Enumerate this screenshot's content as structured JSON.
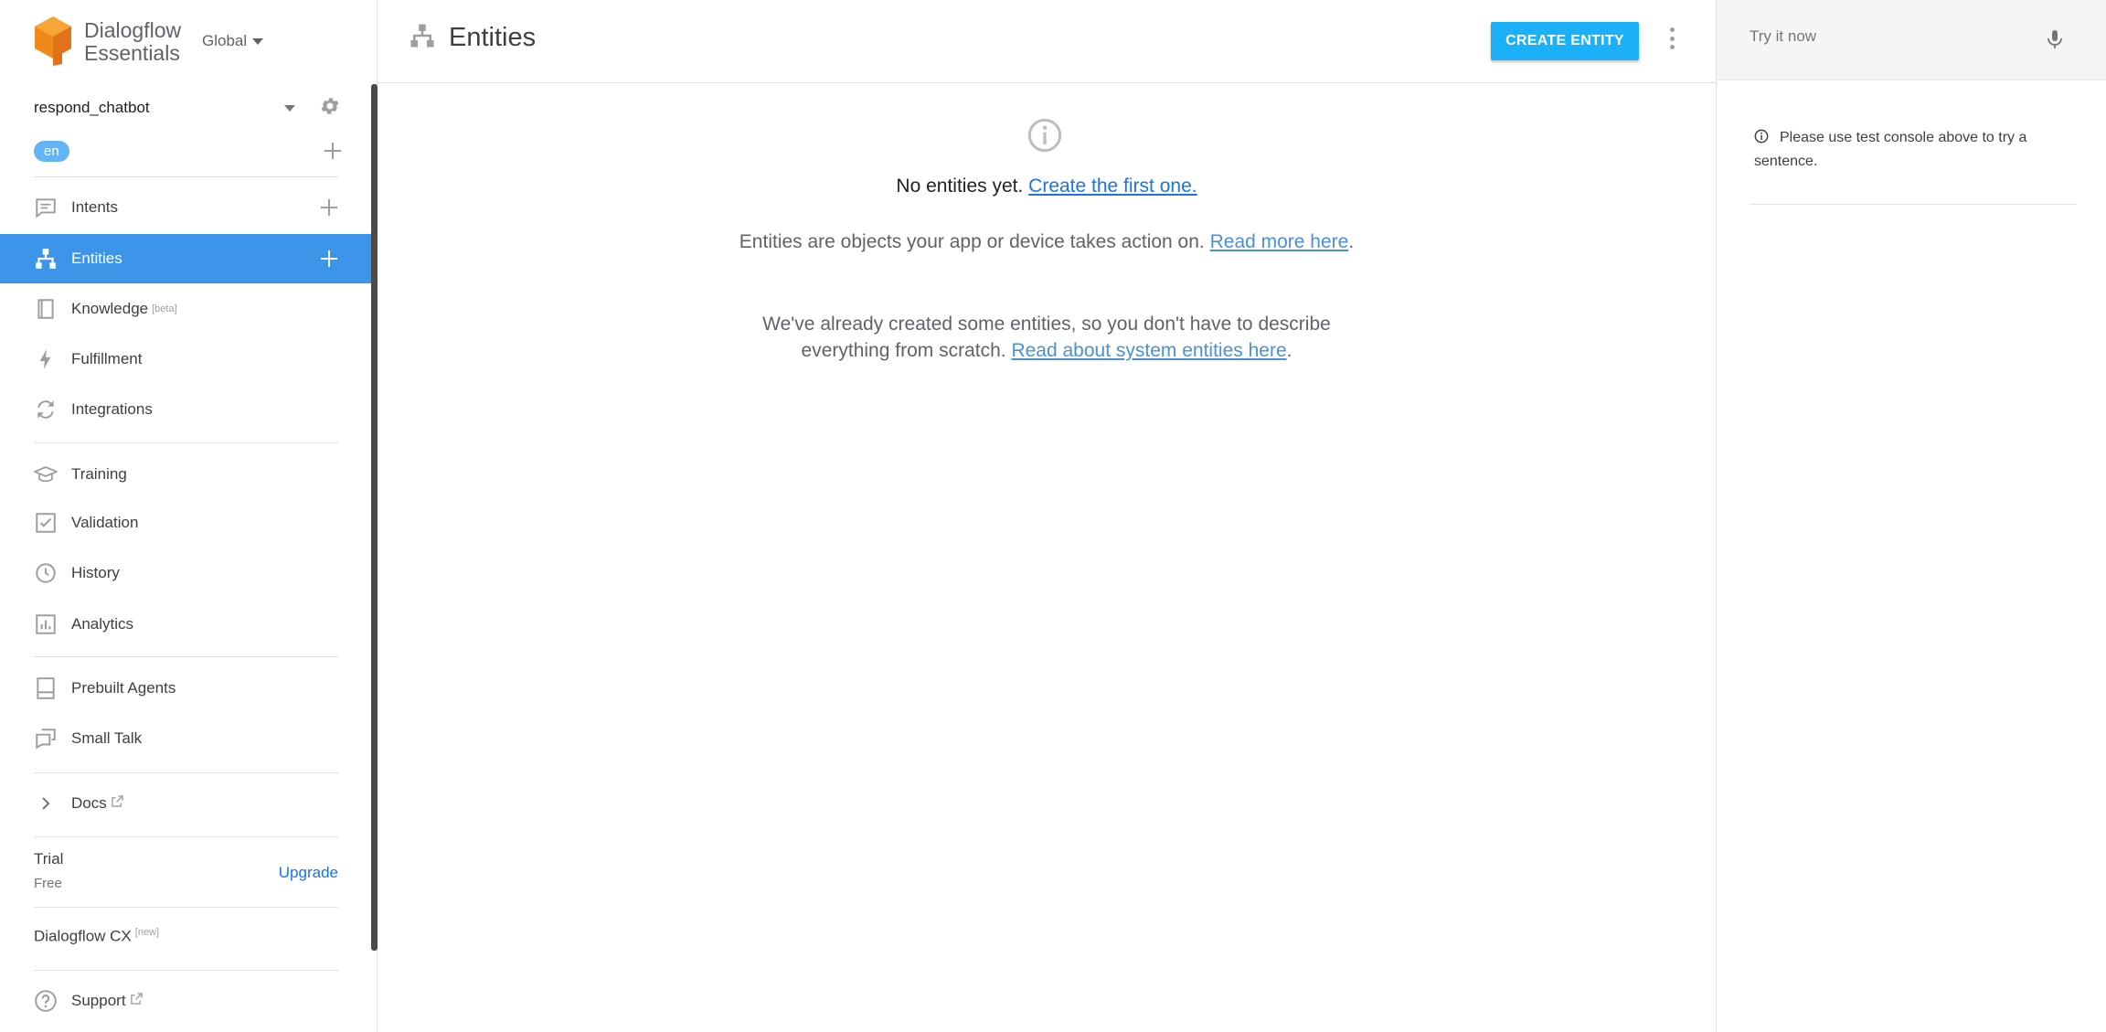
{
  "brand": {
    "line1": "Dialogflow",
    "line2": "Essentials"
  },
  "region": "Global",
  "agent": {
    "name": "respond_chatbot",
    "language": "en"
  },
  "nav": [
    {
      "id": "intents",
      "label": "Intents",
      "icon": "chat-bubble-icon",
      "tag": ""
    },
    {
      "id": "entities",
      "label": "Entities",
      "icon": "hierarchy-icon",
      "tag": ""
    },
    {
      "id": "knowledge",
      "label": "Knowledge",
      "icon": "book-icon",
      "tag": "[beta]"
    },
    {
      "id": "fulfillment",
      "label": "Fulfillment",
      "icon": "lightning-icon",
      "tag": ""
    },
    {
      "id": "integrations",
      "label": "Integrations",
      "icon": "sync-icon",
      "tag": ""
    },
    {
      "id": "training",
      "label": "Training",
      "icon": "graduation-cap-icon",
      "tag": ""
    },
    {
      "id": "validation",
      "label": "Validation",
      "icon": "checkbox-icon",
      "tag": ""
    },
    {
      "id": "history",
      "label": "History",
      "icon": "clock-icon",
      "tag": ""
    },
    {
      "id": "analytics",
      "label": "Analytics",
      "icon": "bar-chart-icon",
      "tag": ""
    },
    {
      "id": "prebuilt",
      "label": "Prebuilt Agents",
      "icon": "bookmark-icon",
      "tag": ""
    },
    {
      "id": "smalltalk",
      "label": "Small Talk",
      "icon": "speech-bubbles-icon",
      "tag": ""
    },
    {
      "id": "docs",
      "label": "Docs",
      "icon": "chevron-right-icon",
      "tag": ""
    },
    {
      "id": "support",
      "label": "Support",
      "icon": "help-circle-icon",
      "tag": ""
    }
  ],
  "trial": {
    "title": "Trial",
    "plan": "Free",
    "upgrade": "Upgrade"
  },
  "cx": {
    "label": "Dialogflow CX",
    "tag": "[new]"
  },
  "header": {
    "title": "Entities",
    "create_button": "CREATE ENTITY"
  },
  "empty_state": {
    "line1_prefix": "No entities yet.",
    "line1_link": "Create the first one.",
    "p1_text": "Entities are objects your app or device takes action on.",
    "p1_link": "Read more here",
    "p2_text_a": "We've already created some entities, so you don't have to describe",
    "p2_text_b": "everything from scratch.",
    "p2_link": "Read about system entities here",
    "period": "."
  },
  "test_console": {
    "placeholder": "Try it now",
    "hint": "Please use test console above to try a sentence."
  },
  "colors": {
    "accent": "#3d95ea",
    "button": "#1bb0f7",
    "brand_orange": "#ef8a1a"
  }
}
